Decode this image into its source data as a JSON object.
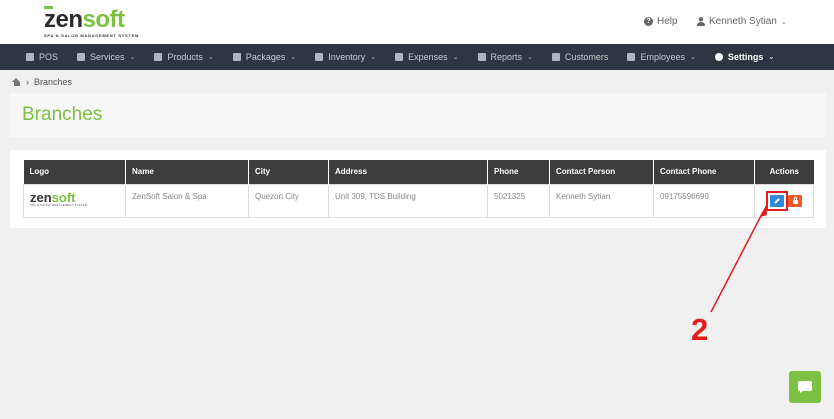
{
  "header": {
    "logo": {
      "zen": "zen",
      "soft": "soft",
      "tagline": "SPA & SALON MANAGEMENT SYSTEM"
    },
    "help_label": "Help",
    "user_name": "Kenneth Sytian"
  },
  "nav": {
    "items": [
      {
        "label": "POS",
        "icon": "pos-icon",
        "has_dropdown": false
      },
      {
        "label": "Services",
        "icon": "services-icon",
        "has_dropdown": true
      },
      {
        "label": "Products",
        "icon": "products-icon",
        "has_dropdown": true
      },
      {
        "label": "Packages",
        "icon": "packages-icon",
        "has_dropdown": true
      },
      {
        "label": "Inventory",
        "icon": "inventory-icon",
        "has_dropdown": true
      },
      {
        "label": "Expenses",
        "icon": "expenses-icon",
        "has_dropdown": true
      },
      {
        "label": "Reports",
        "icon": "reports-icon",
        "has_dropdown": true
      },
      {
        "label": "Customers",
        "icon": "customers-icon",
        "has_dropdown": false
      },
      {
        "label": "Employees",
        "icon": "employees-icon",
        "has_dropdown": true
      },
      {
        "label": "Settings",
        "icon": "gear-icon",
        "has_dropdown": true,
        "active": true
      }
    ]
  },
  "breadcrumb": {
    "current": "Branches"
  },
  "page": {
    "title": "Branches"
  },
  "table": {
    "headers": [
      "Logo",
      "Name",
      "City",
      "Address",
      "Phone",
      "Contact Person",
      "Contact Phone",
      "Actions"
    ],
    "rows": [
      {
        "logo": {
          "zen": "zen",
          "soft": "soft",
          "tagline": "SPA & SALON MANAGEMENT SYSTEM"
        },
        "name": "ZenSoft Salon & Spa",
        "city": "Quezon City",
        "address": "Unit 309, TDS Building",
        "phone": "5021325",
        "contact_person": "Kenneth Sytian",
        "contact_phone": "09175596699"
      }
    ]
  },
  "annotation": {
    "step": "2",
    "color": "#e31b1b"
  },
  "colors": {
    "brand_green": "#7cc142",
    "nav_bg": "#2f3542",
    "edit_blue": "#2e8bd9",
    "delete_orange": "#f05a28"
  }
}
